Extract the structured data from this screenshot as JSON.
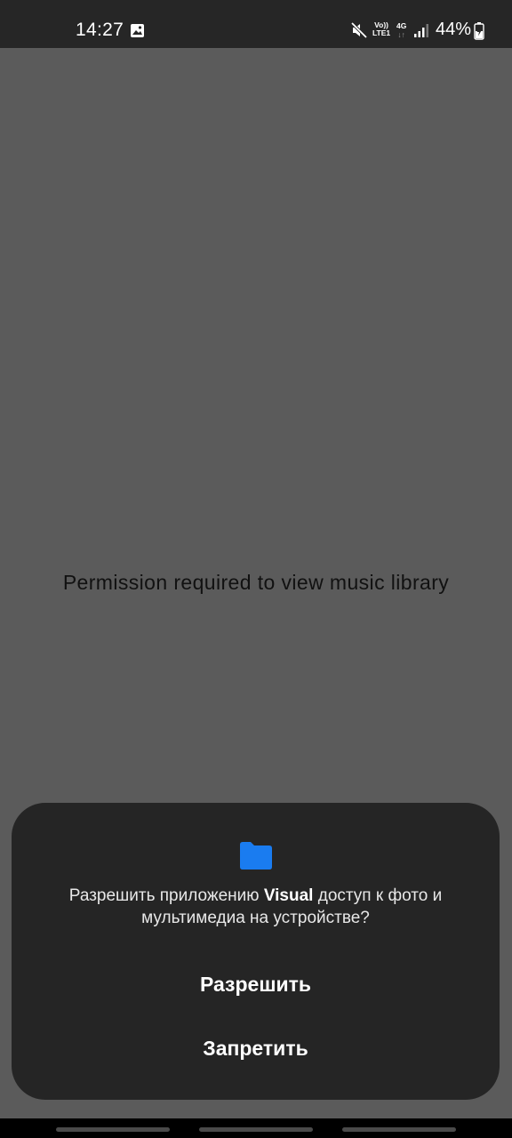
{
  "status_bar": {
    "time": "14:27",
    "volte_top": "Vo))",
    "volte_bottom": "LTE1",
    "network_top": "4G",
    "network_bottom": "↓↑",
    "battery": "44%"
  },
  "main": {
    "message": "Permission required to view music library"
  },
  "dialog": {
    "prompt_prefix": "Разрешить приложению ",
    "app_name": "Visual",
    "prompt_suffix": " доступ к фото и мультимедиа на устройстве?",
    "allow_label": "Разрешить",
    "deny_label": "Запретить",
    "icon": "folder-icon",
    "accent_color": "#1a7cf0"
  }
}
